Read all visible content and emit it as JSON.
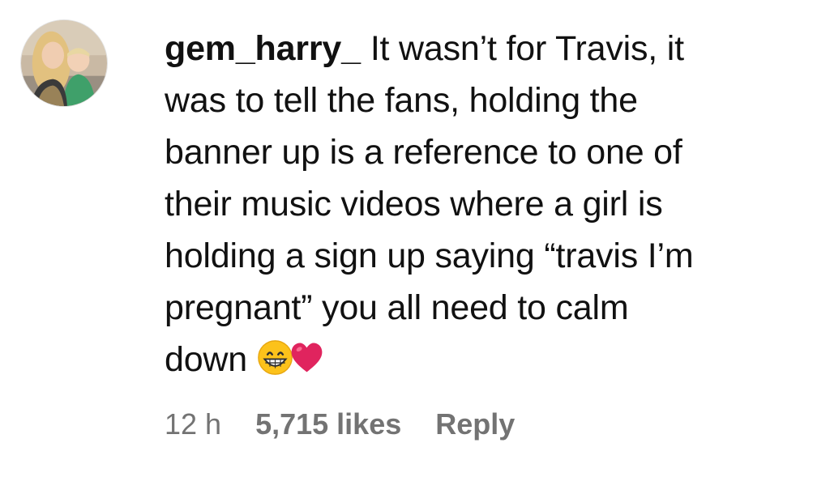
{
  "comment": {
    "username": "gem_harry_",
    "text_lines": [
      "It wasn’t for Travis, it",
      "was to tell the fans, holding the",
      "banner up is a reference to one of",
      "their music videos where a girl is",
      "holding a sign up saying “travis I’m",
      "pregnant” you all need to calm",
      "down"
    ],
    "emojis": [
      "grinning-face-emoji",
      "red-heart-emoji"
    ],
    "timestamp": "12 h",
    "likes": "5,715 likes",
    "reply_label": "Reply"
  },
  "colors": {
    "text": "#111111",
    "meta": "#737373",
    "heart": "#e0245e"
  }
}
